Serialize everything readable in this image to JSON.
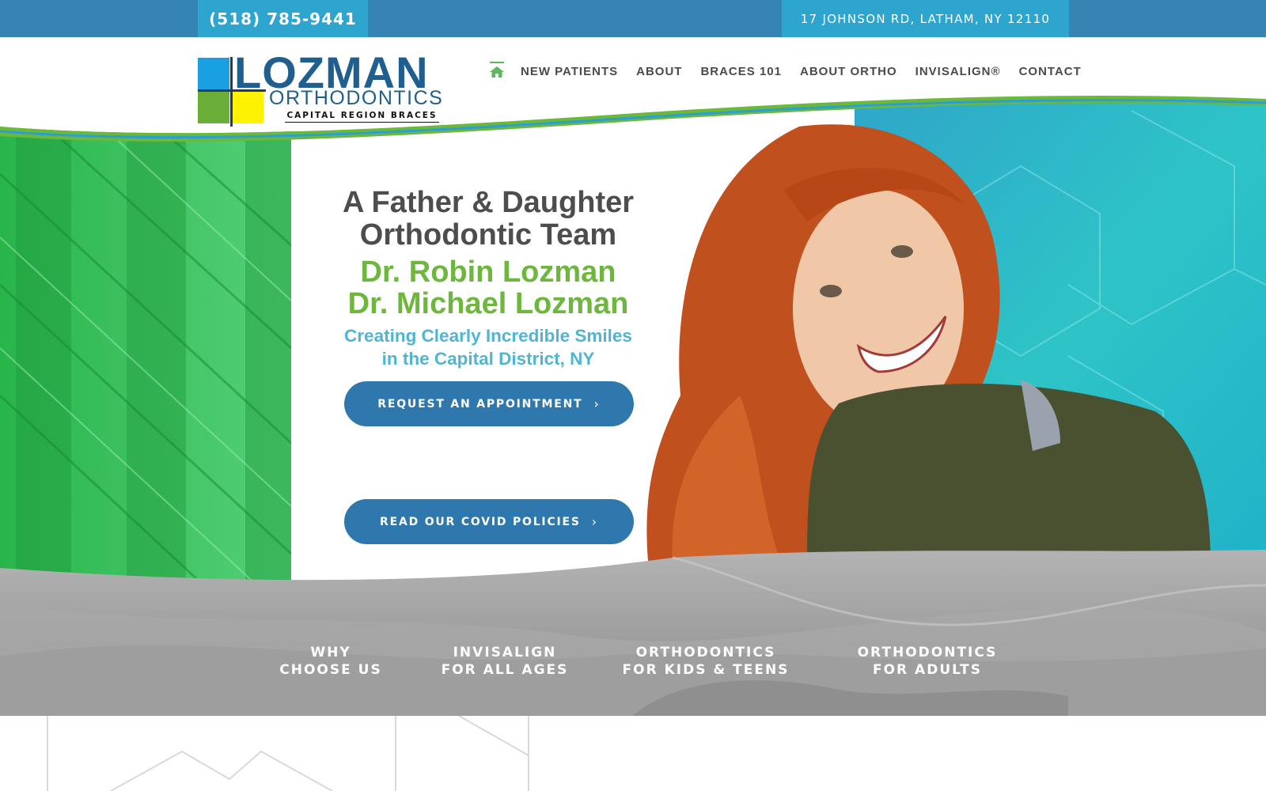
{
  "topbar": {
    "phone": "(518) 785-9441",
    "address": "17 JOHNSON RD, LATHAM, NY 12110"
  },
  "logo": {
    "name": "LOZMAN",
    "subtitle": "ORTHODONTICS",
    "tagline": "CAPITAL REGION BRACES"
  },
  "nav": {
    "home_icon": "home-icon",
    "items": [
      {
        "label": "NEW PATIENTS"
      },
      {
        "label": "ABOUT"
      },
      {
        "label": "BRACES 101"
      },
      {
        "label": "ABOUT ORTHO"
      },
      {
        "label": "INVISALIGN®"
      },
      {
        "label": "CONTACT"
      }
    ]
  },
  "hero": {
    "title_line1": "A Father & Daughter",
    "title_line2": "Orthodontic Team",
    "doctor1": "Dr. Robin Lozman",
    "doctor2": "Dr. Michael Lozman",
    "tagline_line1": "Creating Clearly Incredible Smiles",
    "tagline_line2": "in the Capital District, NY",
    "cta_appointment": "REQUEST AN APPOINTMENT",
    "cta_covid": "READ OUR COVID POLICIES"
  },
  "quick_links": [
    {
      "line1": "WHY",
      "line2": "CHOOSE US"
    },
    {
      "line1": "INVISALIGN",
      "line2": "FOR ALL AGES"
    },
    {
      "line1": "ORTHODONTICS",
      "line2": "FOR KIDS & TEENS"
    },
    {
      "line1": "ORTHODONTICS",
      "line2": "FOR ADULTS"
    }
  ],
  "colors": {
    "topbar": "#3584b3",
    "topbar_accent": "#2da5cf",
    "brand_green": "#6cb73c",
    "brand_blue": "#2f78ad",
    "tagline_teal": "#4fb5d0"
  }
}
